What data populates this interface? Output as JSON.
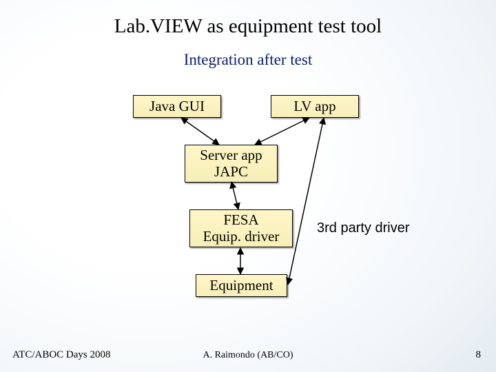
{
  "title": "Lab.VIEW as equipment test tool",
  "subtitle": "Integration after test",
  "boxes": {
    "java_gui": "Java GUI",
    "lv_app": "LV app",
    "server_app_l1": "Server app",
    "server_app_l2": "JAPC",
    "fesa_l1": "FESA",
    "fesa_l2": "Equip. driver",
    "equipment": "Equipment"
  },
  "annotation": "3rd party driver",
  "footer": {
    "left": "ATC/ABOC Days 2008",
    "center": "A. Raimondo (AB/CO)",
    "page": "8"
  },
  "chart_data": {
    "type": "diagram",
    "title": "Lab.VIEW as equipment test tool — Integration after test",
    "nodes": [
      {
        "id": "java_gui",
        "label": "Java GUI"
      },
      {
        "id": "lv_app",
        "label": "LV app"
      },
      {
        "id": "server_app",
        "label": "Server app JAPC"
      },
      {
        "id": "fesa",
        "label": "FESA Equip. driver"
      },
      {
        "id": "equipment",
        "label": "Equipment"
      }
    ],
    "edges": [
      {
        "from": "java_gui",
        "to": "server_app",
        "bidirectional": true
      },
      {
        "from": "lv_app",
        "to": "server_app",
        "bidirectional": true
      },
      {
        "from": "server_app",
        "to": "fesa",
        "bidirectional": true
      },
      {
        "from": "fesa",
        "to": "equipment",
        "bidirectional": true
      },
      {
        "from": "lv_app",
        "to": "equipment",
        "bidirectional": true
      }
    ],
    "annotations": [
      {
        "text": "3rd party driver",
        "attached_to": "lv_app→equipment"
      }
    ]
  }
}
